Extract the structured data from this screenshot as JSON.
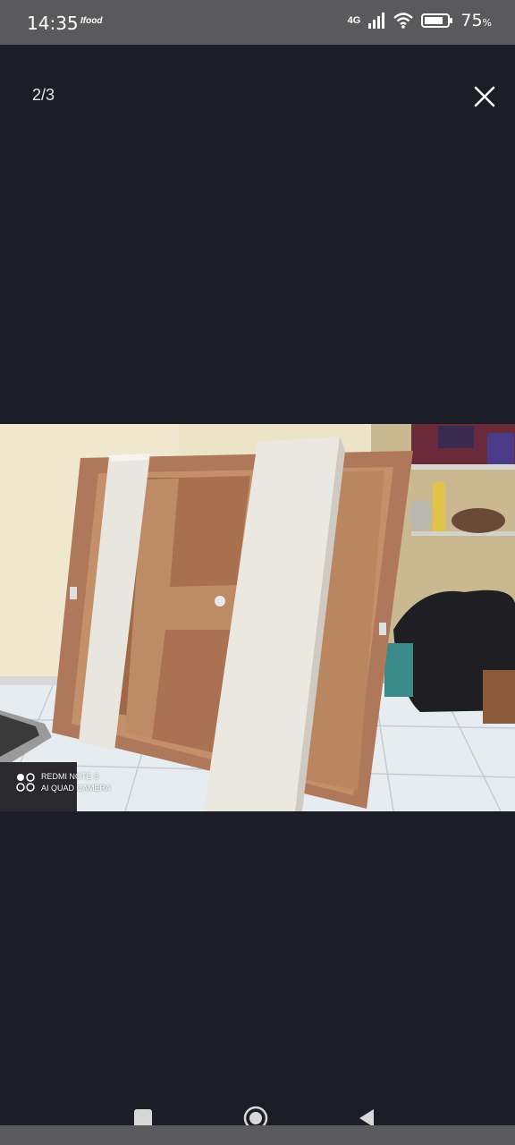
{
  "status_bar": {
    "time": "14:35",
    "notification": "Ifood",
    "network": "4G",
    "battery": "75",
    "battery_unit": "%",
    "icons": [
      "signal-icon",
      "wifi-icon",
      "battery-icon"
    ]
  },
  "viewer": {
    "counter": "2/3",
    "close_icon": "close-icon",
    "image_alt": "Wooden door frames and white shelf panels leaning against a wall"
  },
  "watermark": {
    "line1": "REDMI NOTE 8",
    "line2": "AI QUAD CAMERA"
  },
  "nav_bar": {
    "icons": [
      "recents-icon",
      "home-icon",
      "back-icon"
    ]
  },
  "colors": {
    "background": "#1b1e26",
    "status_bar": "#5a5a5c"
  }
}
